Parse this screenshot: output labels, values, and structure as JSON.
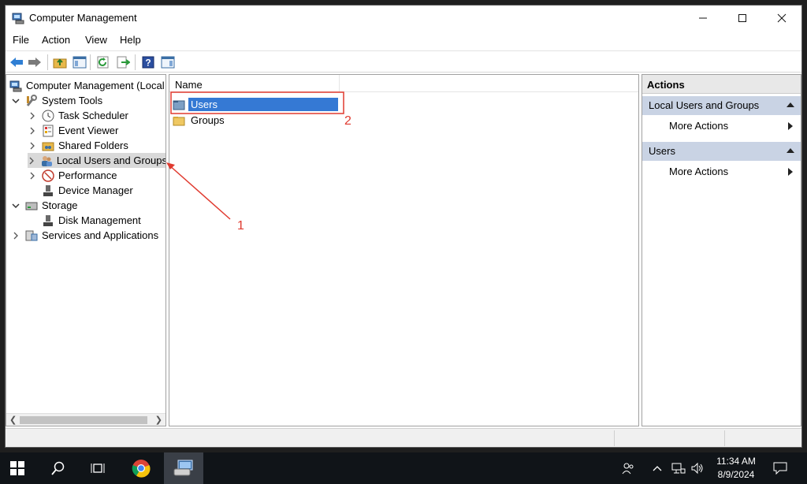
{
  "window": {
    "title": "Computer Management",
    "controls": [
      "minimize",
      "maximize",
      "close"
    ]
  },
  "menu": [
    "File",
    "Action",
    "View",
    "Help"
  ],
  "toolbar": {
    "icons": [
      "back-icon",
      "forward-icon",
      "up-folder-icon",
      "show-hide-tree-icon",
      "refresh-icon",
      "export-list-icon",
      "help-icon",
      "show-hide-action-pane-icon"
    ]
  },
  "tree": {
    "root": "Computer Management (Local",
    "items": [
      {
        "label": "System Tools",
        "icon": "tools-icon"
      },
      {
        "label": "Task Scheduler",
        "icon": "clock-icon"
      },
      {
        "label": "Event Viewer",
        "icon": "event-viewer-icon"
      },
      {
        "label": "Shared Folders",
        "icon": "shared-folder-icon"
      },
      {
        "label": "Local Users and Groups",
        "icon": "users-icon"
      },
      {
        "label": "Performance",
        "icon": "performance-icon"
      },
      {
        "label": "Device Manager",
        "icon": "device-manager-icon"
      },
      {
        "label": "Storage",
        "icon": "storage-icon"
      },
      {
        "label": "Disk Management",
        "icon": "disk-icon"
      },
      {
        "label": "Services and Applications",
        "icon": "services-icon"
      }
    ],
    "selected": "Local Users and Groups"
  },
  "list": {
    "column": "Name",
    "items": [
      {
        "label": "Users",
        "icon": "folder-users-icon",
        "selected": true
      },
      {
        "label": "Groups",
        "icon": "folder-icon",
        "selected": false
      }
    ]
  },
  "actions": {
    "title": "Actions",
    "groups": [
      {
        "label": "Local Users and Groups",
        "item": "More Actions"
      },
      {
        "label": "Users",
        "item": "More Actions"
      }
    ]
  },
  "annotations": {
    "label1": "1",
    "label2": "2",
    "color": "#e03a2f"
  },
  "taskbar": {
    "apps": [
      "windows-start-icon",
      "search-icon",
      "task-view-icon",
      "chrome-icon",
      "computer-management-icon"
    ],
    "time": "11:34 AM",
    "date": "8/9/2024"
  }
}
